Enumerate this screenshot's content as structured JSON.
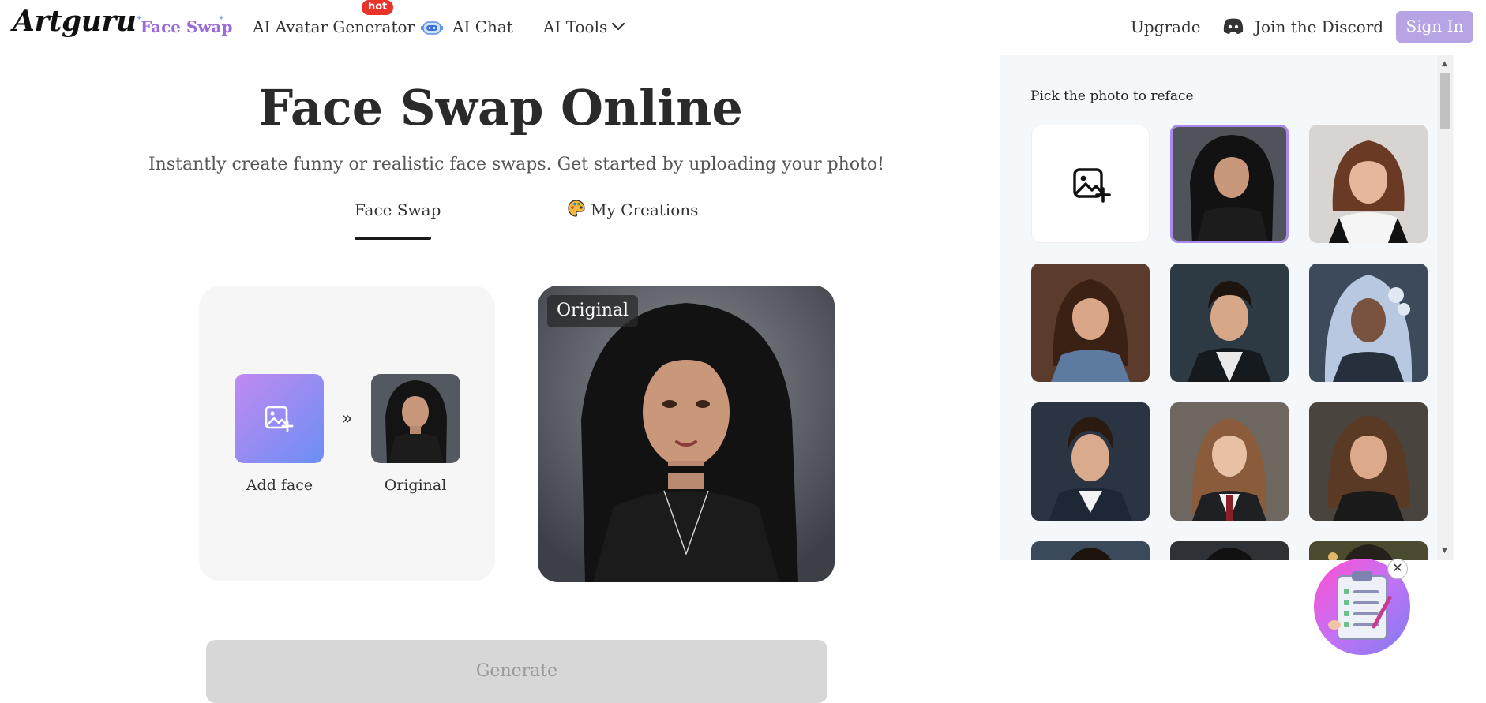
{
  "header": {
    "logo": "Artguru",
    "nav": [
      {
        "label": "Face Swap",
        "active": true
      },
      {
        "label": "AI Avatar Generator",
        "badge": "hot"
      },
      {
        "label": "AI Chat",
        "icon": "robot-icon"
      },
      {
        "label": "AI Tools",
        "icon": "chevron-down-icon"
      }
    ],
    "upgrade": "Upgrade",
    "discord": "Join the Discord",
    "sign_in": "Sign In"
  },
  "main": {
    "title": "Face Swap Online",
    "subtitle": "Instantly create funny or realistic face swaps. Get started by uploading your photo!",
    "tabs": [
      {
        "label": "Face Swap",
        "active": true
      },
      {
        "label": "My Creations",
        "icon": "palette-icon"
      }
    ],
    "swap": {
      "add_face_label": "Add face",
      "original_label": "Original",
      "arrow": "»"
    },
    "preview_badge": "Original",
    "generate_label": "Generate"
  },
  "panel": {
    "title": "Pick the photo to reface",
    "selected_index": 1
  },
  "colors": {
    "accent": "#9b6bd9",
    "signin_bg": "#b6a4e4",
    "hot_badge": "#e8322a",
    "generate_disabled": "#d7d7d7"
  }
}
